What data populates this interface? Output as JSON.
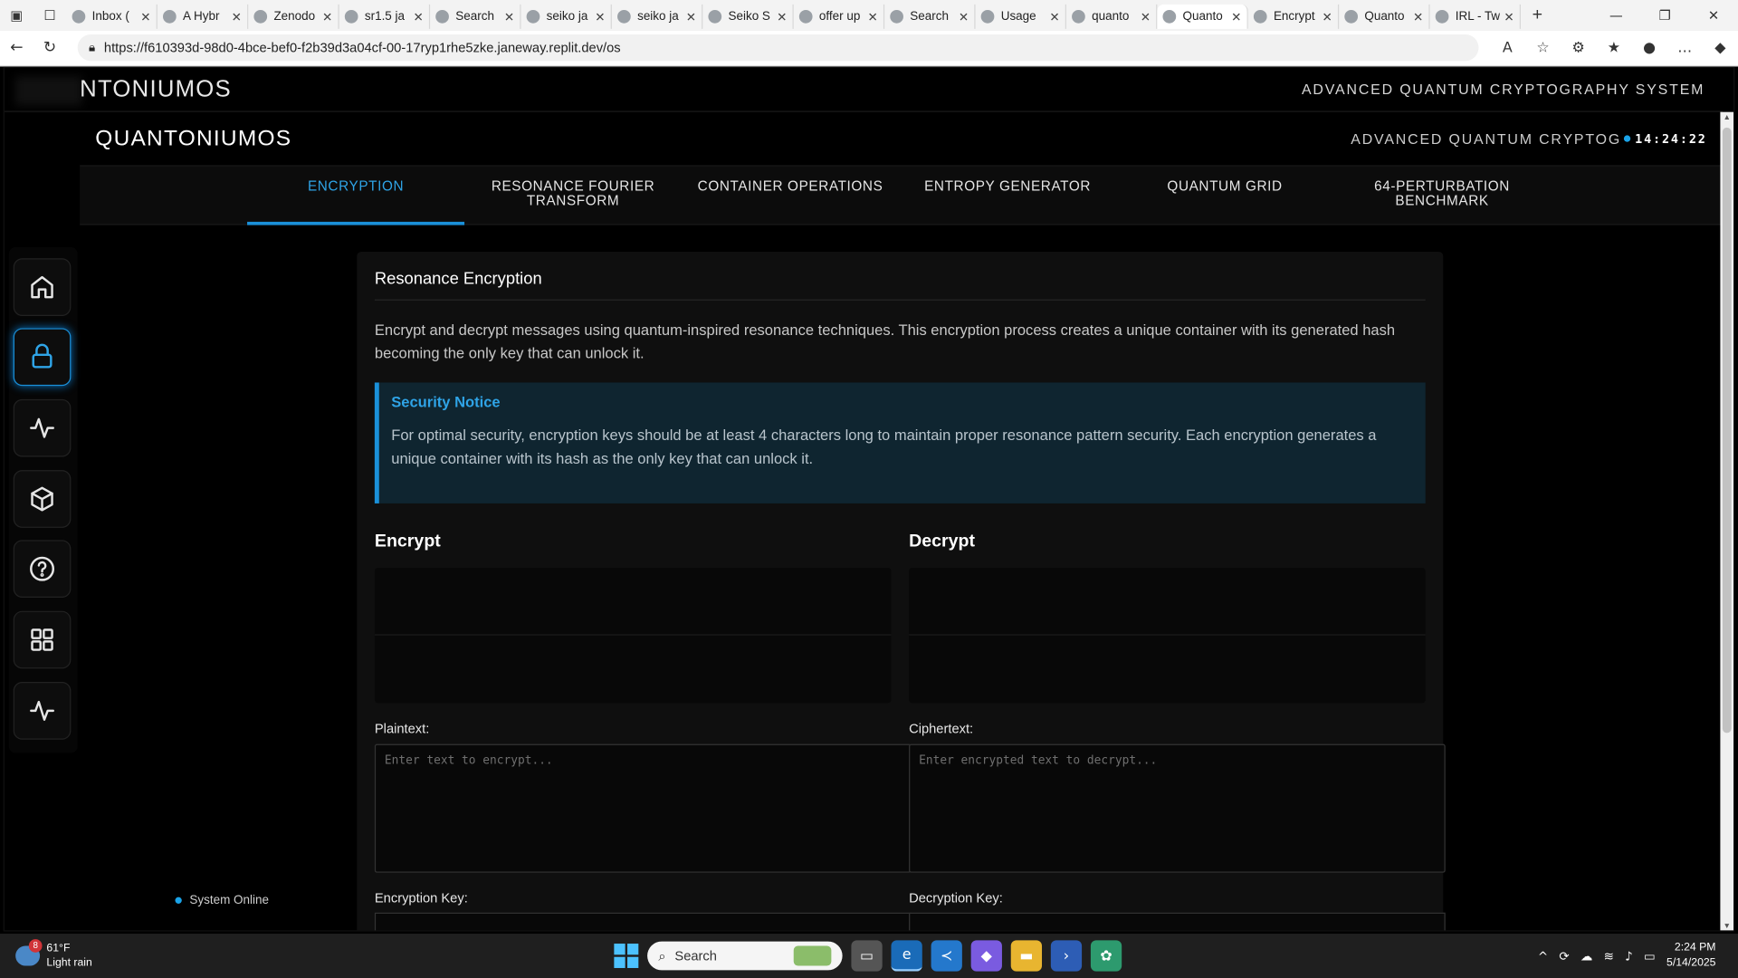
{
  "browser": {
    "tabs": [
      {
        "title": "Inbox (",
        "active": false
      },
      {
        "title": "A Hybr",
        "active": false
      },
      {
        "title": "Zenodo",
        "active": false
      },
      {
        "title": "sr1.5 ja",
        "active": false
      },
      {
        "title": "Search",
        "active": false
      },
      {
        "title": "seiko ja",
        "active": false
      },
      {
        "title": "seiko ja",
        "active": false
      },
      {
        "title": "Seiko S",
        "active": false
      },
      {
        "title": "offer up",
        "active": false
      },
      {
        "title": "Search",
        "active": false
      },
      {
        "title": "Usage",
        "active": false
      },
      {
        "title": "quanto",
        "active": false
      },
      {
        "title": "Quanto",
        "active": true
      },
      {
        "title": "Encrypt",
        "active": false
      },
      {
        "title": "Quanto",
        "active": false
      },
      {
        "title": "IRL - Tw",
        "active": false
      }
    ],
    "url": "https://f610393d-98d0-4bce-bef0-f2b39d3a04cf-00-17ryp1rhe5zke.janeway.replit.dev/os"
  },
  "outer_header": {
    "logo": "NTONIUMOS",
    "subtitle": "ADVANCED QUANTUM CRYPTOGRAPHY SYSTEM"
  },
  "inner_header": {
    "logo": "QUANTONIUMOS",
    "subtitle": "ADVANCED QUANTUM CRYPTOGRAPHY",
    "clock": "14:24:22"
  },
  "nav_tabs": [
    {
      "label": "ENCRYPTION",
      "active": true
    },
    {
      "label": "RESONANCE FOURIER TRANSFORM",
      "active": false
    },
    {
      "label": "CONTAINER OPERATIONS",
      "active": false
    },
    {
      "label": "ENTROPY GENERATOR",
      "active": false
    },
    {
      "label": "QUANTUM GRID",
      "active": false
    },
    {
      "label": "64-PERTURBATION BENCHMARK",
      "active": false
    }
  ],
  "sidebar": {
    "items": [
      {
        "icon": "home-icon",
        "active": false
      },
      {
        "icon": "lock-icon",
        "active": true
      },
      {
        "icon": "activity-icon",
        "active": false
      },
      {
        "icon": "cube-icon",
        "active": false
      },
      {
        "icon": "help-icon",
        "active": false
      },
      {
        "icon": "grid-icon",
        "active": false
      },
      {
        "icon": "pulse-icon",
        "active": false
      }
    ],
    "status": "System Online"
  },
  "card": {
    "title": "Resonance Encryption",
    "description": "Encrypt and decrypt messages using quantum-inspired resonance techniques. This encryption process creates a unique container with its generated hash becoming the only key that can unlock it.",
    "notice_title": "Security Notice",
    "notice_body": "For optimal security, encryption keys should be at least 4 characters long to maintain proper resonance pattern security. Each encryption generates a unique container with its hash as the only key that can unlock it."
  },
  "encrypt": {
    "title": "Encrypt",
    "plaintext_label": "Plaintext:",
    "plaintext_placeholder": "Enter text to encrypt...",
    "key_label": "Encryption Key:"
  },
  "decrypt": {
    "title": "Decrypt",
    "ciphertext_label": "Ciphertext:",
    "ciphertext_placeholder": "Enter encrypted text to decrypt...",
    "key_label": "Decryption Key:"
  },
  "taskbar": {
    "weather_temp": "61°F",
    "weather_desc": "Light rain",
    "weather_badge": "8",
    "search_placeholder": "Search",
    "time": "2:24 PM",
    "date": "5/14/2025"
  },
  "colors": {
    "accent": "#1a90d9",
    "accent_text": "#2fa4e7",
    "notice_bg": "#0f2530"
  }
}
